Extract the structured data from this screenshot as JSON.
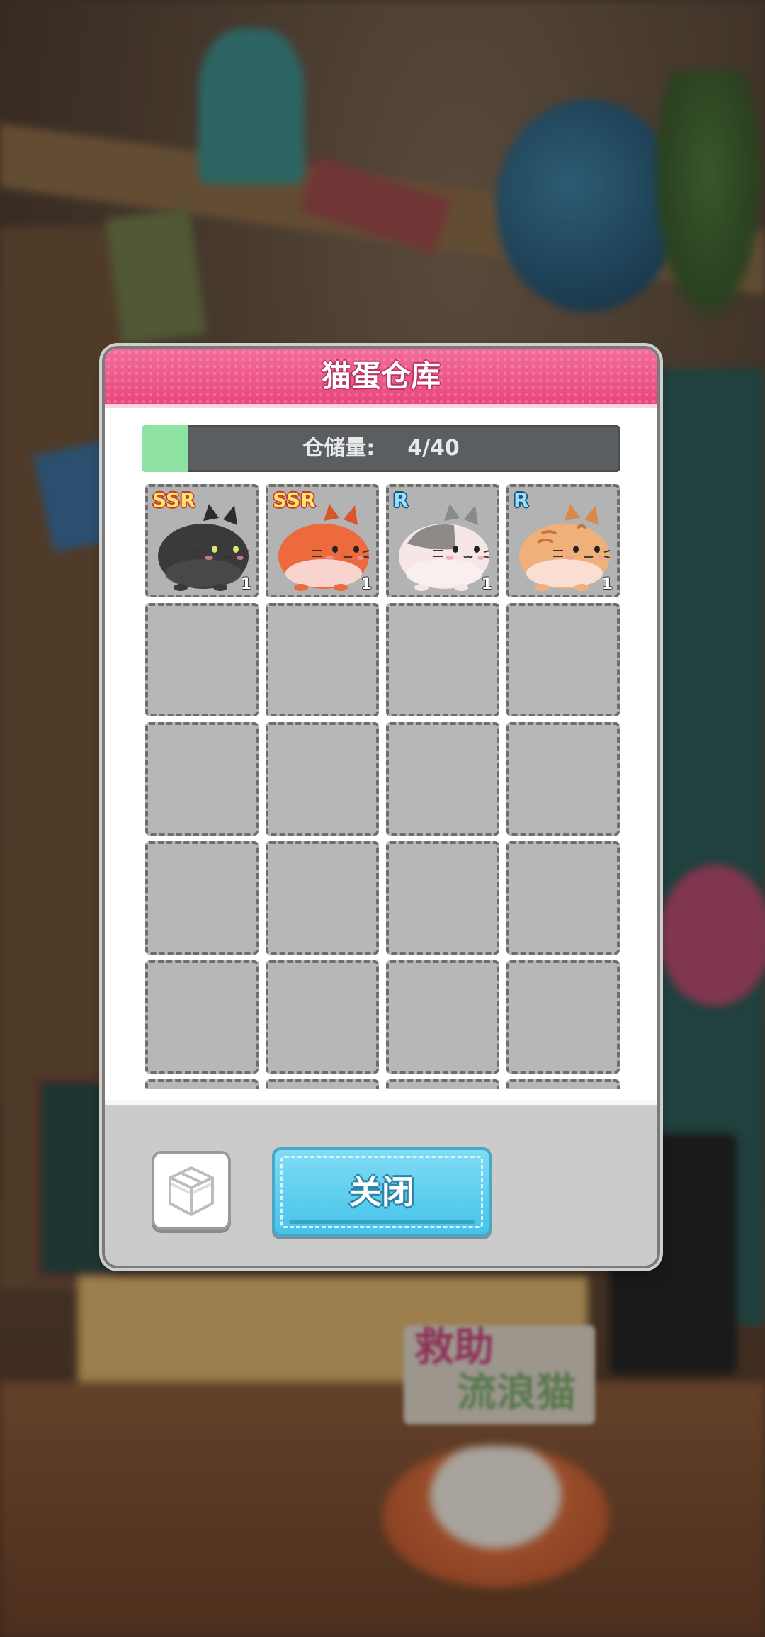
{
  "dialog": {
    "title": "猫蛋仓库",
    "storage": {
      "label": "仓储量:",
      "value": "4/40",
      "used": 4,
      "capacity": 40
    },
    "slots": [
      {
        "rarity": "SSR",
        "count": "1",
        "cat": "black-cat"
      },
      {
        "rarity": "SSR",
        "count": "1",
        "cat": "orange-cat"
      },
      {
        "rarity": "R",
        "count": "1",
        "cat": "gray-white-cat"
      },
      {
        "rarity": "R",
        "count": "1",
        "cat": "tabby-cat"
      }
    ],
    "empty_slots_visible": 20,
    "footer": {
      "close_label": "关闭",
      "box_icon": "box-icon"
    }
  },
  "background": {
    "sign_line1": "救助",
    "sign_line2": "流浪猫"
  },
  "colors": {
    "header_pink": "#e9477f",
    "storage_fill": "#8ee2a2",
    "close_button": "#45c3ea",
    "ssr_color": "#ffe36a",
    "r_color": "#8fe6ff"
  }
}
